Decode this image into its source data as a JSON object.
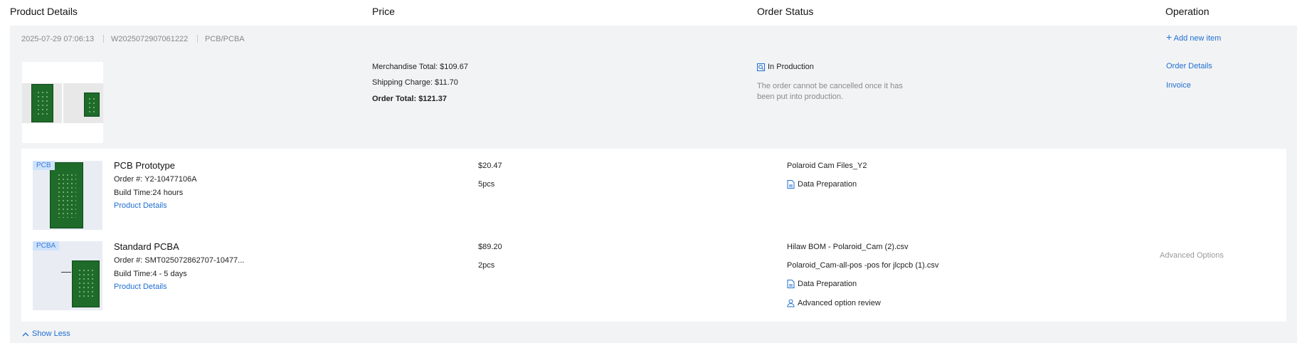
{
  "header": {
    "col_product": "Product Details",
    "col_price": "Price",
    "col_status": "Order Status",
    "col_operation": "Operation"
  },
  "order": {
    "datetime": "2025-07-29 07:06:13",
    "order_number": "W2025072907061222",
    "category": "PCB/PCBA",
    "add_item_label": "Add new item",
    "merch_total": "Merchandise Total: $109.67",
    "shipping": "Shipping Charge: $11.70",
    "order_total": "Order Total: $121.37",
    "status": "In Production",
    "status_note_1": "The order cannot be cancelled once it has",
    "status_note_2": "been put into production.",
    "order_details_link": "Order Details",
    "invoice_link": "Invoice"
  },
  "items": [
    {
      "tag": "PCB",
      "name": "PCB Prototype",
      "order_no": "Order #: Y2-10477106A",
      "build_time": "Build Time:24 hours",
      "details_link": "Product Details",
      "price": "$20.47",
      "qty": "5pcs",
      "files": [
        "Polaroid Cam Files_Y2"
      ],
      "status_1": "Data Preparation"
    },
    {
      "tag": "PCBA",
      "name": "Standard PCBA",
      "order_no": "Order #: SMT025072862707-10477...",
      "build_time": "Build Time:4 - 5 days",
      "details_link": "Product Details",
      "price": "$89.20",
      "qty": "2pcs",
      "files": [
        "Hilaw BOM - Polaroid_Cam (2).csv",
        "Polaroid_Cam-all-pos -pos for jlcpcb (1).csv"
      ],
      "status_1": "Data Preparation",
      "status_2": "Advanced option review",
      "operation": "Advanced Options"
    }
  ],
  "show_less": "Show Less",
  "colors": {
    "link": "#1f6fd1",
    "panel": "#f2f3f5",
    "tag_bg": "#cfe2fb"
  }
}
